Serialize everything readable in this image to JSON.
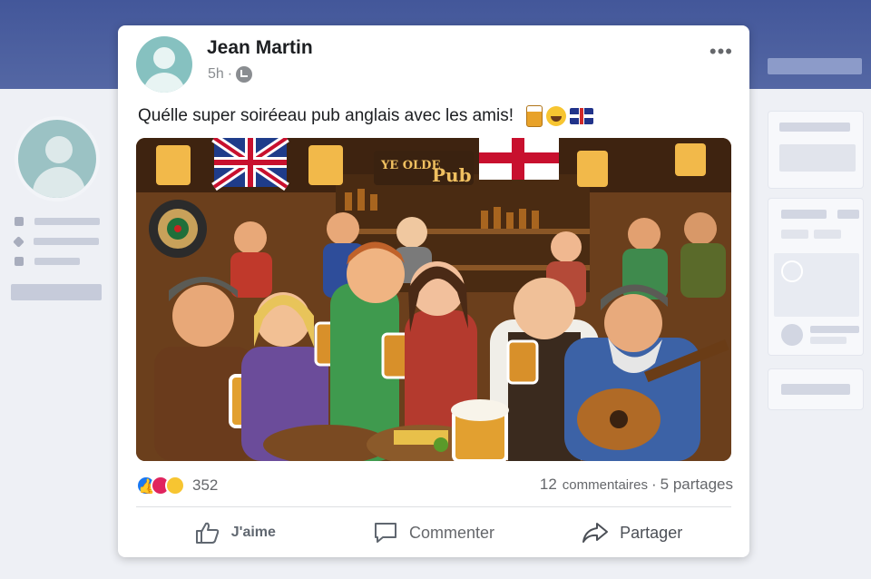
{
  "post": {
    "author": "Jean Martin",
    "time": "5h",
    "separator": "·",
    "privacy_icon": "globe-icon",
    "more_icon": "more-options-icon",
    "more_label": "•••",
    "text": "Quélle super soiréeau pub anglais avec les amis!",
    "text_emojis": [
      "beer-mug-emoji",
      "laughing-emoji",
      "uk-flag-emoji"
    ],
    "image_description_icon": "pub-photo",
    "image_sign_text": "YE OLDE Pub"
  },
  "engagement": {
    "reaction_icons": [
      "like-reaction-icon",
      "love-reaction-icon",
      "haha-reaction-icon"
    ],
    "reaction_count": "352",
    "comment_count": "12",
    "comments_label": "commentaires",
    "shares_separator": "·",
    "shares_label": "5 partages"
  },
  "actions": {
    "like": "J'aime",
    "comment": "Commenter",
    "share": "Partager"
  },
  "colors": {
    "header_band": "#4a5f9c",
    "card_bg": "#ffffff",
    "like_blue": "#1877f2",
    "love_red": "#e0245e",
    "haha_yellow": "#f7c531",
    "muted_text": "#65676b"
  }
}
